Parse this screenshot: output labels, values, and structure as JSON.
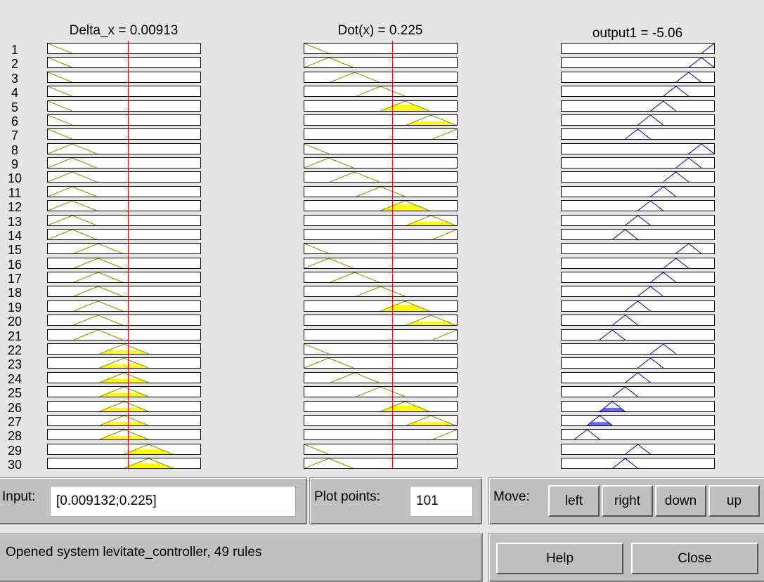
{
  "columns": [
    {
      "title": "Delta_x = 0.00913",
      "range": [
        -0.18,
        0.18
      ],
      "value": 0.009132
    },
    {
      "title": "Dot(x) = 0.225",
      "range": [
        -1.5,
        1.5
      ],
      "value": 0.225
    },
    {
      "title": "output1 = -5.06"
    }
  ],
  "rules": [
    {
      "label": "1"
    },
    {
      "label": "2"
    },
    {
      "label": "3"
    },
    {
      "label": "4"
    },
    {
      "label": "5"
    },
    {
      "label": "6"
    },
    {
      "label": "7"
    },
    {
      "label": "8"
    },
    {
      "label": "9"
    },
    {
      "label": "10"
    },
    {
      "label": "11"
    },
    {
      "label": "12"
    },
    {
      "label": "13"
    },
    {
      "label": "14"
    },
    {
      "label": "15"
    },
    {
      "label": "16"
    },
    {
      "label": "17"
    },
    {
      "label": "18"
    },
    {
      "label": "19"
    },
    {
      "label": "20"
    },
    {
      "label": "21"
    },
    {
      "label": "22"
    },
    {
      "label": "23"
    },
    {
      "label": "24"
    },
    {
      "label": "25"
    },
    {
      "label": "26"
    },
    {
      "label": "27"
    },
    {
      "label": "28"
    },
    {
      "label": "29"
    },
    {
      "label": "30"
    }
  ],
  "membership": {
    "input1_mf": [
      0,
      0,
      0,
      0,
      0,
      0,
      0,
      1,
      1,
      1,
      1,
      1,
      1,
      1,
      2,
      2,
      2,
      2,
      2,
      2,
      2,
      3,
      3,
      3,
      3,
      3,
      3,
      3,
      4,
      4
    ],
    "input2_mf": [
      0,
      1,
      2,
      3,
      4,
      5,
      6,
      0,
      1,
      2,
      3,
      4,
      5,
      6,
      0,
      1,
      2,
      3,
      4,
      5,
      6,
      0,
      1,
      2,
      3,
      4,
      5,
      6,
      0,
      1
    ],
    "output_mf": [
      12,
      11,
      10,
      9,
      8,
      7,
      6,
      11,
      10,
      9,
      8,
      7,
      6,
      5,
      10,
      9,
      8,
      7,
      6,
      5,
      4,
      8,
      7,
      6,
      5,
      4,
      3,
      2,
      6,
      5
    ],
    "input1_centers": [
      0.0,
      0.16,
      0.33,
      0.5,
      0.66,
      0.83,
      1.0
    ],
    "input2_centers": [
      0.0,
      0.16,
      0.33,
      0.5,
      0.66,
      0.83,
      1.0
    ],
    "output_centers": [
      0.0,
      0.083,
      0.167,
      0.25,
      0.333,
      0.417,
      0.5,
      0.583,
      0.667,
      0.75,
      0.833,
      0.917,
      1.0
    ],
    "input1_firing": [
      0,
      0,
      0,
      0,
      0,
      0,
      0,
      0,
      0,
      0,
      0,
      0,
      0,
      0,
      0,
      0,
      0,
      0,
      0,
      0,
      0,
      0.37,
      0.37,
      0.37,
      0.37,
      0.37,
      0.37,
      0.37,
      0.48,
      0.48
    ],
    "input2_firing": [
      0,
      0,
      0,
      0,
      0.62,
      0.35,
      0,
      0,
      0,
      0,
      0,
      0.62,
      0.35,
      0,
      0,
      0,
      0,
      0,
      0.62,
      0.35,
      0,
      0,
      0,
      0,
      0,
      0.62,
      0.35,
      0,
      0,
      0
    ],
    "output_firing": [
      0,
      0,
      0,
      0,
      0,
      0,
      0,
      0,
      0,
      0,
      0,
      0,
      0,
      0,
      0,
      0,
      0,
      0,
      0,
      0,
      0,
      0,
      0,
      0,
      0,
      0.37,
      0.35,
      0,
      0,
      0
    ]
  },
  "colors": {
    "input_line": "#8b8b00",
    "input_fill": "#ffff00",
    "output_line": "#00008b",
    "output_fill": "#6a6aff",
    "indicator": "#e00000"
  },
  "controls": {
    "input_label": "Input:",
    "input_value": "[0.009132;0.225]",
    "plot_points_label": "Plot points:",
    "plot_points_value": "101",
    "move_label": "Move:",
    "left": "left",
    "right": "right",
    "down": "down",
    "up": "up"
  },
  "status": "Opened system levitate_controller, 49 rules",
  "help_label": "Help",
  "close_label": "Close"
}
